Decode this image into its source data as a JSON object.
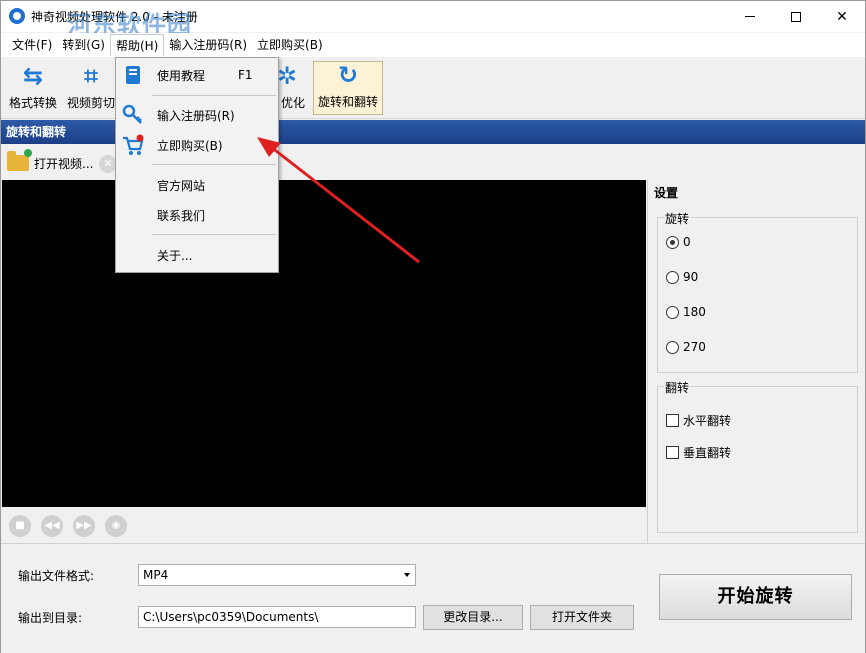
{
  "window": {
    "title": "神奇视频处理软件 2.0 - 未注册",
    "watermark": "河东软件园",
    "watermark_url": "www.pc0359.cn"
  },
  "menubar": [
    {
      "label": "文件(F)"
    },
    {
      "label": "转到(G)"
    },
    {
      "label": "帮助(H)"
    },
    {
      "label": "输入注册码(R)"
    },
    {
      "label": "立即购买(B)"
    }
  ],
  "toolbar": {
    "items": [
      {
        "label": "格式转换",
        "icon": "format-convert-icon"
      },
      {
        "label": "视频剪切",
        "icon": "crop-icon"
      },
      {
        "label": "优化",
        "icon": "optimize-icon"
      },
      {
        "label": "旋转和翻转",
        "icon": "rotate-icon"
      }
    ]
  },
  "section_title": "旋转和翻转",
  "open_video_label": "打开视频...",
  "help_menu": {
    "items": [
      {
        "label": "使用教程",
        "shortcut": "F1",
        "icon": "book-icon"
      },
      {
        "label": "输入注册码(R)",
        "icon": "key-icon"
      },
      {
        "label": "立即购买(B)",
        "icon": "cart-icon"
      },
      {
        "label": "官方网站"
      },
      {
        "label": "联系我们"
      },
      {
        "label": "关于..."
      }
    ]
  },
  "settings": {
    "title": "设置",
    "rotate_group": "旋转",
    "rotate_options": [
      "0",
      "90",
      "180",
      "270"
    ],
    "rotate_selected": "0",
    "flip_group": "翻转",
    "flip_options": [
      "水平翻转",
      "垂直翻转"
    ]
  },
  "output": {
    "format_label": "输出文件格式:",
    "format_value": "MP4",
    "dir_label": "输出到目录:",
    "dir_value": "C:\\Users\\pc0359\\Documents\\",
    "change_dir_button": "更改目录...",
    "open_folder_button": "打开文件夹",
    "start_button": "开始旋转"
  },
  "colors": {
    "accent": "#1f7ad6",
    "header_bg": "#2d5aa8",
    "annotation_arrow": "#e02020"
  }
}
